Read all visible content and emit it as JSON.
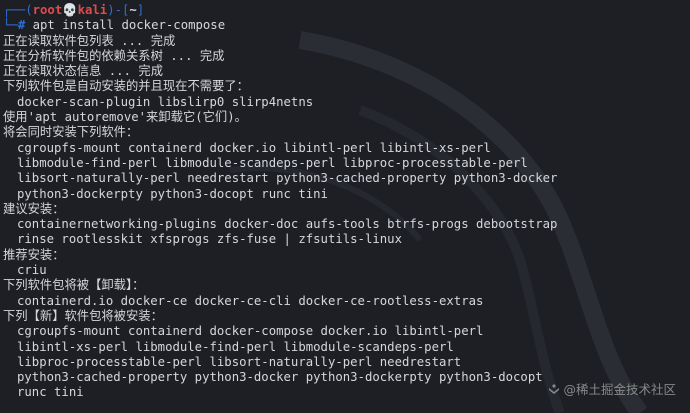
{
  "prompt": {
    "frame_open": "┌──(",
    "user": "root",
    "skull": "💀",
    "host": "kali",
    "frame_mid": ")-[",
    "path": "~",
    "frame_close": "]",
    "frame_bottom": "└─",
    "hash": "#",
    "command": " apt install docker-compose"
  },
  "lines": [
    {
      "text": "正在读取软件包列表 ... 完成",
      "indent": false
    },
    {
      "text": "正在分析软件包的依赖关系树 ... 完成",
      "indent": false
    },
    {
      "text": "正在读取状态信息 ... 完成",
      "indent": false
    },
    {
      "text": "下列软件包是自动安装的并且现在不需要了：",
      "indent": false
    },
    {
      "text": "docker-scan-plugin libslirp0 slirp4netns",
      "indent": true
    },
    {
      "text": "使用'apt autoremove'来卸载它(它们)。",
      "indent": false
    },
    {
      "text": "将会同时安装下列软件：",
      "indent": false
    },
    {
      "text": "cgroupfs-mount containerd docker.io libintl-perl libintl-xs-perl",
      "indent": true
    },
    {
      "text": "libmodule-find-perl libmodule-scandeps-perl libproc-processtable-perl",
      "indent": true
    },
    {
      "text": "libsort-naturally-perl needrestart python3-cached-property python3-docker",
      "indent": true
    },
    {
      "text": "python3-dockerpty python3-docopt runc tini",
      "indent": true
    },
    {
      "text": "建议安装：",
      "indent": false
    },
    {
      "text": "containernetworking-plugins docker-doc aufs-tools btrfs-progs debootstrap",
      "indent": true
    },
    {
      "text": "rinse rootlesskit xfsprogs zfs-fuse | zfsutils-linux",
      "indent": true
    },
    {
      "text": "推荐安装：",
      "indent": false
    },
    {
      "text": "criu",
      "indent": true
    },
    {
      "text": "下列软件包将被【卸载】：",
      "indent": false
    },
    {
      "text": "containerd.io docker-ce docker-ce-cli docker-ce-rootless-extras",
      "indent": true
    },
    {
      "text": "下列【新】软件包将被安装：",
      "indent": false
    },
    {
      "text": "cgroupfs-mount containerd docker-compose docker.io libintl-perl",
      "indent": true
    },
    {
      "text": "libintl-xs-perl libmodule-find-perl libmodule-scandeps-perl",
      "indent": true
    },
    {
      "text": "libproc-processtable-perl libsort-naturally-perl needrestart",
      "indent": true
    },
    {
      "text": "python3-cached-property python3-docker python3-dockerpty python3-docopt",
      "indent": true
    },
    {
      "text": "runc tini",
      "indent": true
    }
  ],
  "watermark": "@稀土掘金技术社区",
  "colors": {
    "background": "#1d1f24",
    "text": "#d5d7db",
    "prompt_frame": "#2f6fd0",
    "prompt_user": "#e14b4b"
  }
}
